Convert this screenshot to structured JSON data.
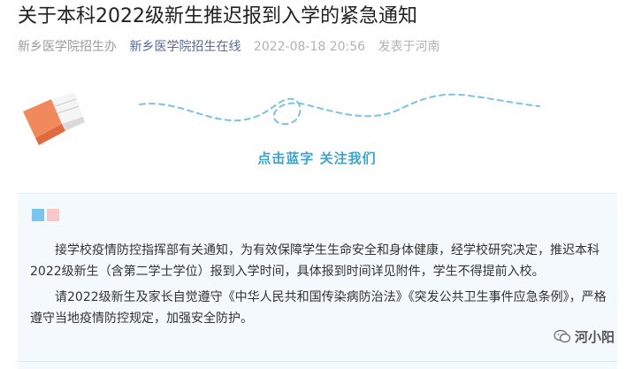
{
  "article": {
    "title": "关于本科2022级新生推迟报到入学的紧急通知",
    "author": "新乡医学院招生办",
    "account": "新乡医学院招生在线",
    "datetime": "2022-08-18 20:56",
    "location": "发表于河南"
  },
  "banner": {
    "follow_text": "点击蓝字 关注我们"
  },
  "body": {
    "paragraphs": [
      "接学校疫情防控指挥部有关通知，为有效保障学生生命安全和身体健康，经学校研究决定，推迟本科2022级新生（含第二学士学位）报到入学时间，具体报到时间详见附件，学生不得提前入校。",
      "请2022级新生及家长自觉遵守《中华人民共和国传染病防治法》《突发公共卫生事件应急条例》，严格遵守当地疫情防控规定，加强安全防护。"
    ]
  },
  "watermark": {
    "text": "河小阳"
  },
  "colors": {
    "accent": "#3fa3c9",
    "link": "#576b95",
    "card_bg": "#f3f9fd",
    "book": "#f08a5d"
  },
  "icons": [
    "book-icon",
    "wavy-line-decoration",
    "wechat-icon"
  ]
}
